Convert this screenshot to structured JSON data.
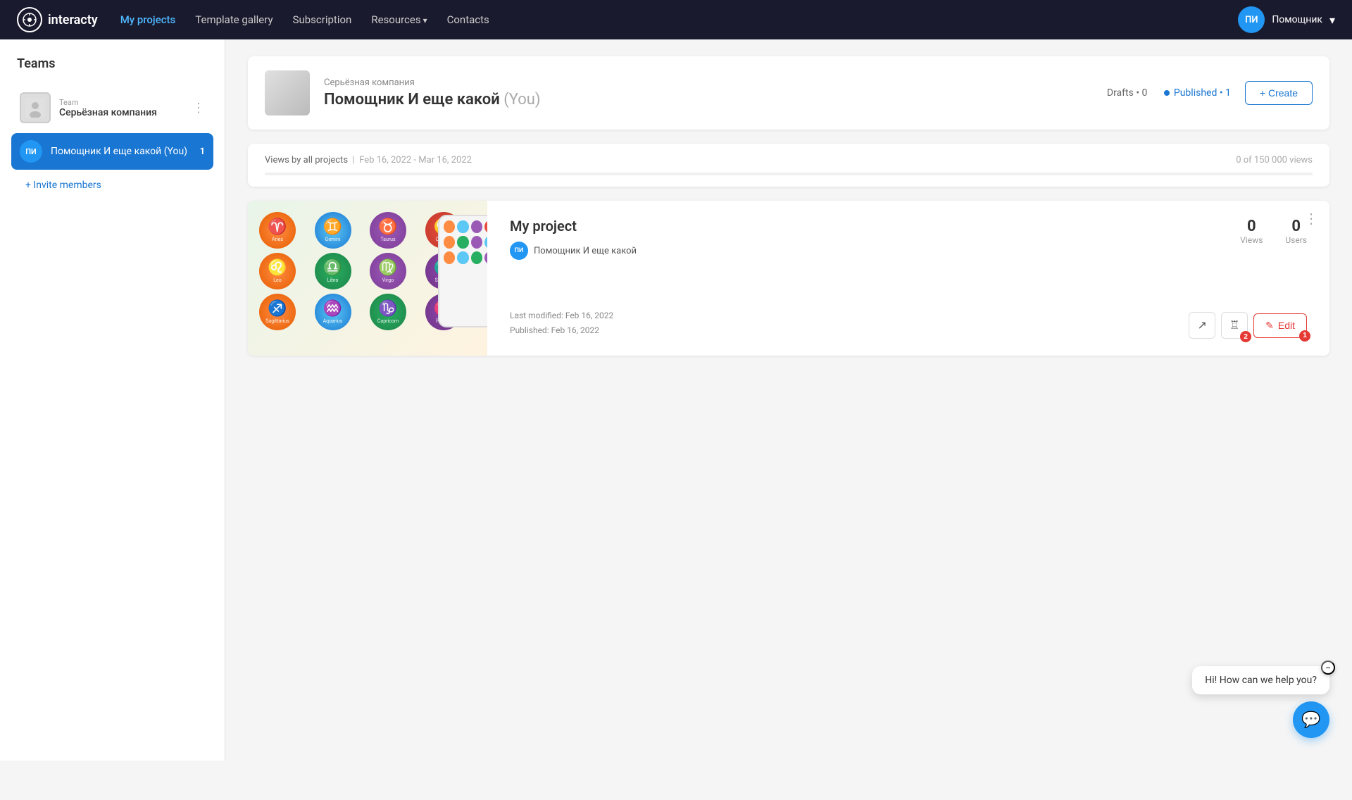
{
  "navbar": {
    "logo_text": "interacty",
    "nav_items": [
      {
        "label": "My projects",
        "active": true
      },
      {
        "label": "Template gallery",
        "active": false
      },
      {
        "label": "Subscription",
        "active": false
      },
      {
        "label": "Resources",
        "active": false,
        "has_arrow": true
      },
      {
        "label": "Contacts",
        "active": false
      }
    ],
    "user": {
      "initials": "ПИ",
      "name": "Помощник",
      "chevron": "▾"
    }
  },
  "sidebar": {
    "title": "Teams",
    "team": {
      "label": "Team",
      "name": "Серьёзная компания"
    },
    "member": {
      "initials": "ПИ",
      "name": "Помощник И еще какой (You)",
      "count": "1"
    },
    "invite_label": "+ Invite members"
  },
  "project_header": {
    "company_name": "Серьёзная компания",
    "project_title": "Помощник И еще какой",
    "you_label": "(You)",
    "drafts_label": "Drafts",
    "drafts_count": "0",
    "published_label": "Published",
    "published_count": "1",
    "create_label": "+ Create"
  },
  "views_bar": {
    "label": "Views by all projects",
    "separator": "|",
    "date_range": "Feb 16, 2022 - Mar 16, 2022",
    "count_text": "0 of 150 000 views",
    "progress": 0
  },
  "project_card": {
    "title": "My project",
    "author_initials": "ПИ",
    "author_name": "Помощник И еще какой",
    "views_value": "0",
    "views_label": "Views",
    "users_value": "0",
    "users_label": "Users",
    "last_modified_label": "Last modified:",
    "last_modified_date": "Feb 16, 2022",
    "published_label": "Published:",
    "published_date": "Feb 16, 2022",
    "badge_analytics": "2",
    "badge_edit": "1",
    "edit_label": "Edit"
  },
  "zodiac_signs": [
    {
      "symbol": "♈",
      "name": "Aries",
      "class": "z-aries"
    },
    {
      "symbol": "♊",
      "name": "Gemini",
      "class": "z-gemini"
    },
    {
      "symbol": "♉",
      "name": "Taurus",
      "class": "z-taurus"
    },
    {
      "symbol": "♋",
      "name": "Cancer",
      "class": "z-cancer"
    },
    {
      "symbol": "♌",
      "name": "Leo",
      "class": "z-leo"
    },
    {
      "symbol": "♎",
      "name": "Libra",
      "class": "z-libra"
    },
    {
      "symbol": "♍",
      "name": "Virgo",
      "class": "z-virgo"
    },
    {
      "symbol": "♏",
      "name": "Scorpio",
      "class": "z-scorpio"
    },
    {
      "symbol": "♐",
      "name": "Sagittarius",
      "class": "z-sagittarius"
    },
    {
      "symbol": "♒",
      "name": "Aquarius",
      "class": "z-aquarius"
    },
    {
      "symbol": "♑",
      "name": "Capricorn",
      "class": "z-capricorn"
    },
    {
      "symbol": "♓",
      "name": "Pisces",
      "class": "z-pisces"
    }
  ],
  "chat": {
    "message": "Hi! How can we help you?",
    "close_icon": "−"
  }
}
